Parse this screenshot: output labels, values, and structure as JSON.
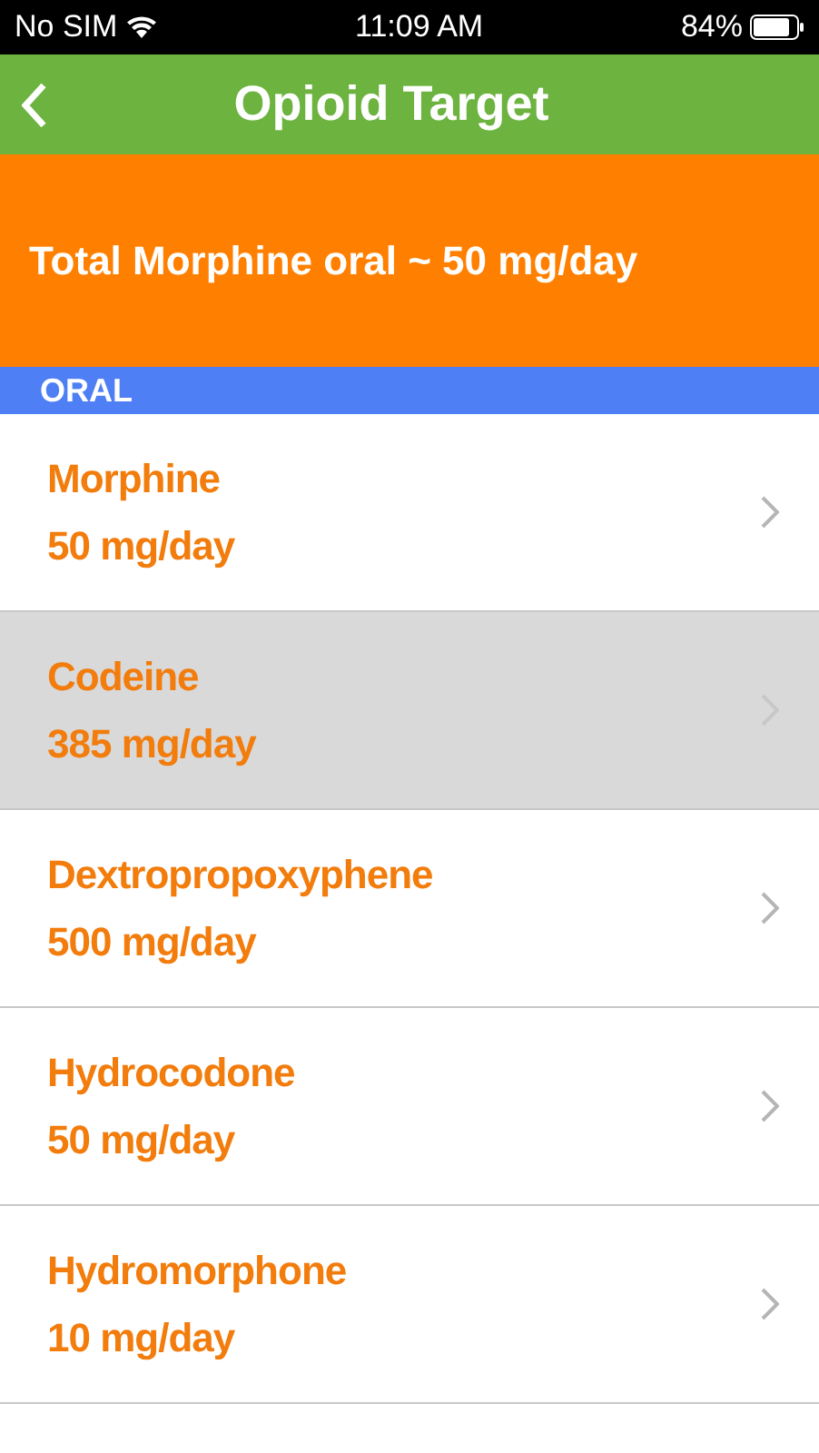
{
  "status_bar": {
    "carrier": "No SIM",
    "time": "11:09 AM",
    "battery": "84%"
  },
  "nav": {
    "title": "Opioid Target"
  },
  "banner": "Total Morphine oral ~ 50 mg/day",
  "section": "ORAL",
  "items": [
    {
      "name": "Morphine",
      "dose": "50 mg/day",
      "selected": false
    },
    {
      "name": "Codeine",
      "dose": "385 mg/day",
      "selected": true
    },
    {
      "name": "Dextropropoxyphene",
      "dose": "500 mg/day",
      "selected": false
    },
    {
      "name": "Hydrocodone",
      "dose": "50 mg/day",
      "selected": false
    },
    {
      "name": "Hydromorphone",
      "dose": "10 mg/day",
      "selected": false
    }
  ]
}
